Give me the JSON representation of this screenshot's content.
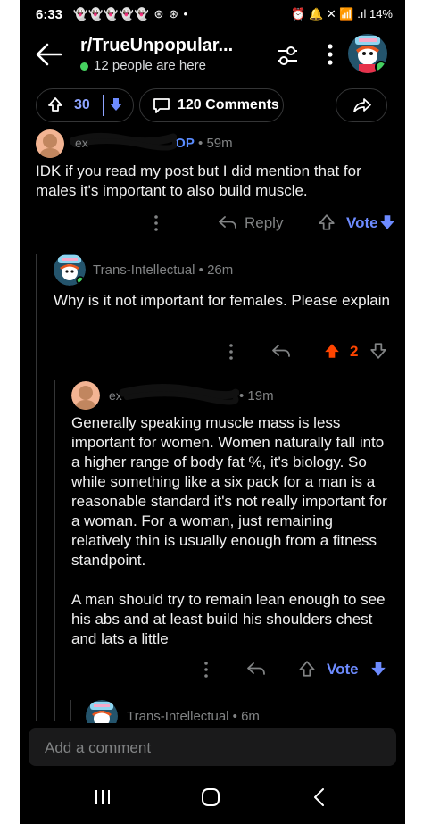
{
  "status_bar": {
    "time": "6:33",
    "notification_icons": "👻👻👻👻👻 ⊛ ⊛ •",
    "right_icons": "⏰ 🔔 ✕ 📶 .ıl",
    "battery": "14%"
  },
  "header": {
    "subreddit": "r/TrueUnpopular...",
    "presence": "12 people are here"
  },
  "post_actions": {
    "vote_count": "30",
    "comments_label": "120 Comments"
  },
  "comments": [
    {
      "username_visible_suffix": "OP",
      "time": "59m",
      "body": "IDK if you read my post but I did mention that for males it's important to also build muscle.",
      "reply_label": "Reply",
      "vote_label": "Vote"
    },
    {
      "username": "Trans-Intellectual",
      "time": "26m",
      "body": "Why is it not important for females. Please explain",
      "score": "2"
    },
    {
      "time": "19m",
      "body_paragraph_1": "Generally speaking muscle mass is less important for women. Women naturally fall into a higher range of body fat %, it's biology. So while something like a six pack for a man is a reasonable standard it's not really important for a woman. For a woman, just remaining relatively thin is usually enough from a fitness standpoint.",
      "body_paragraph_2": "A man should try to remain lean enough to see his abs and at least build his shoulders chest and lats a little",
      "vote_label": "Vote"
    },
    {
      "username": "Trans-Intellectual",
      "time": "6m"
    }
  ],
  "composer": {
    "placeholder": "Add a comment"
  },
  "colors": {
    "background": "#000000",
    "upvote_blue": "#8ea4ff",
    "vote_blue": "#6d8bff",
    "upvoted_orange": "#ff4500",
    "op_blue": "#5a8cff"
  },
  "icons": [
    "back-arrow-icon",
    "filter-icon",
    "more-icon",
    "upvote-icon",
    "downvote-icon",
    "comment-icon",
    "share-icon",
    "reply-icon",
    "nav-recents-icon",
    "nav-home-icon",
    "nav-back-icon"
  ]
}
